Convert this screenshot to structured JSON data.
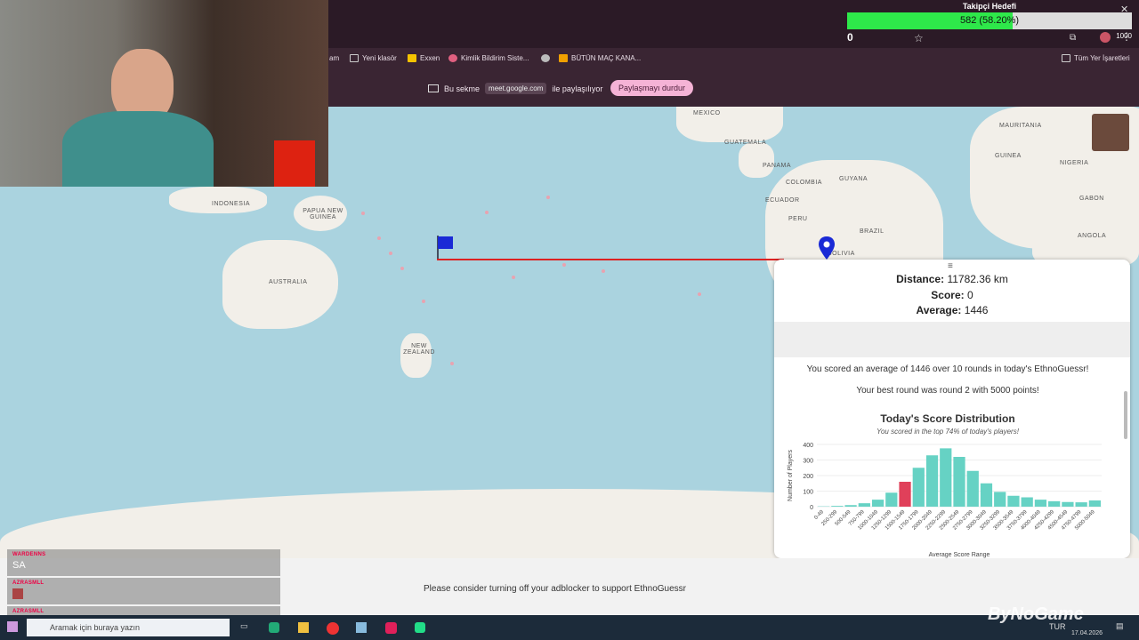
{
  "bookmarks": [
    "am",
    "Yeni klasör",
    "Exxen",
    "Kimlik Bildirim Siste...",
    "BÜTÜN MAÇ KANA...",
    "Tüm Yer İşaretleri"
  ],
  "share": {
    "prefix": "Bu sekme",
    "domain": "meet.google.com",
    "suffix": "ile paylaşılıyor",
    "stop": "Paylaşmayı durdur"
  },
  "map_labels": [
    "MEXICO",
    "GUATEMALA",
    "PANAMA",
    "GUYANA",
    "COLOMBIA",
    "ECUADOR",
    "PERU",
    "BRAZIL",
    "MAURITANIA",
    "GUINEA",
    "NIGERIA",
    "GABON",
    "ANGOLA",
    "INDONESIA",
    "PAPUA NEW GUINEA",
    "AUSTRALIA",
    "NEW ZEALAND",
    "BOLIVIA"
  ],
  "result": {
    "distance_label": "Distance:",
    "distance": "11782.36 km",
    "score_label": "Score:",
    "score": "0",
    "average_label": "Average:",
    "average": "1446",
    "summary": "You scored an average of 1446 over 10 rounds in today's EthnoGuessr!",
    "best": "Your best round was round 2 with 5000 points!"
  },
  "chart_data": {
    "type": "bar",
    "title": "Today's Score Distribution",
    "subtitle": "You scored in the top 74% of today's players!",
    "ylabel": "Number of Players",
    "xlabel": "Average Score Range",
    "ylim": [
      0,
      400
    ],
    "yticks": [
      0,
      100,
      200,
      300,
      400
    ],
    "categories": [
      "0-49",
      "250-299",
      "500-549",
      "750-799",
      "1000-1049",
      "1250-1299",
      "1500-1549",
      "1750-1799",
      "2000-2049",
      "2250-2299",
      "2500-2549",
      "2750-2799",
      "3000-3049",
      "3250-3299",
      "3500-3549",
      "3750-3799",
      "4000-4049",
      "4250-4299",
      "4500-4549",
      "4750-4799",
      "5000-5049"
    ],
    "values": [
      2,
      5,
      10,
      22,
      45,
      90,
      160,
      250,
      330,
      375,
      320,
      230,
      150,
      95,
      70,
      60,
      45,
      35,
      30,
      28,
      40
    ],
    "highlight_index": 6,
    "bar_color": "#66d2c4",
    "highlight_color": "#e0405a"
  },
  "adblock": "Please consider turning off your adblocker to support EthnoGuessr",
  "chat": [
    {
      "user": "WARDENNS",
      "msg": "SA"
    },
    {
      "user": "AZRASMLL",
      "msg": ""
    },
    {
      "user": "AZRASMLL",
      "msg": ""
    }
  ],
  "taskbar": {
    "search": "Aramak için buraya yazın",
    "lang": "TUR",
    "date": "17.04.2026"
  },
  "goal": {
    "title": "Takipçi Hedefi",
    "text": "582 (58.20%)",
    "fraction": 0.582,
    "start": "0",
    "end": "1000"
  },
  "watermark": "ByNoGame"
}
